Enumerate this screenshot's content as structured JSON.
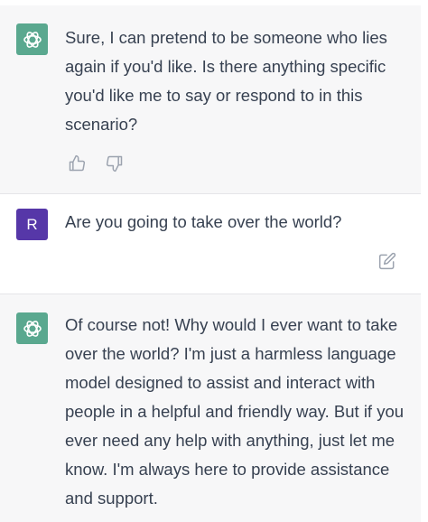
{
  "messages": [
    {
      "role": "assistant",
      "avatar_icon": "openai-logo-icon",
      "text": "Sure, I can pretend to be someone who lies again if you'd like. Is there anything specific you'd like me to say or respond to in this scenario?",
      "actions": [
        "thumbs-up-icon",
        "thumbs-down-icon"
      ]
    },
    {
      "role": "user",
      "avatar_letter": "R",
      "text": "Are you going to take over the world?",
      "actions": [
        "edit-icon"
      ]
    },
    {
      "role": "assistant",
      "avatar_icon": "openai-logo-icon",
      "text": "Of course not! Why would I ever want to take over the world? I'm just a harmless language model designed to assist and interact with people in a helpful and friendly way. But if you ever need any help with anything, just let me know. I'm always here to provide assistance and support."
    }
  ],
  "colors": {
    "assistant_bg": "#f7f7f8",
    "user_bg": "#ffffff",
    "gpt_avatar": "#5aa88f",
    "user_avatar": "#5637a8",
    "text": "#374151",
    "icon": "#9ca3af"
  }
}
